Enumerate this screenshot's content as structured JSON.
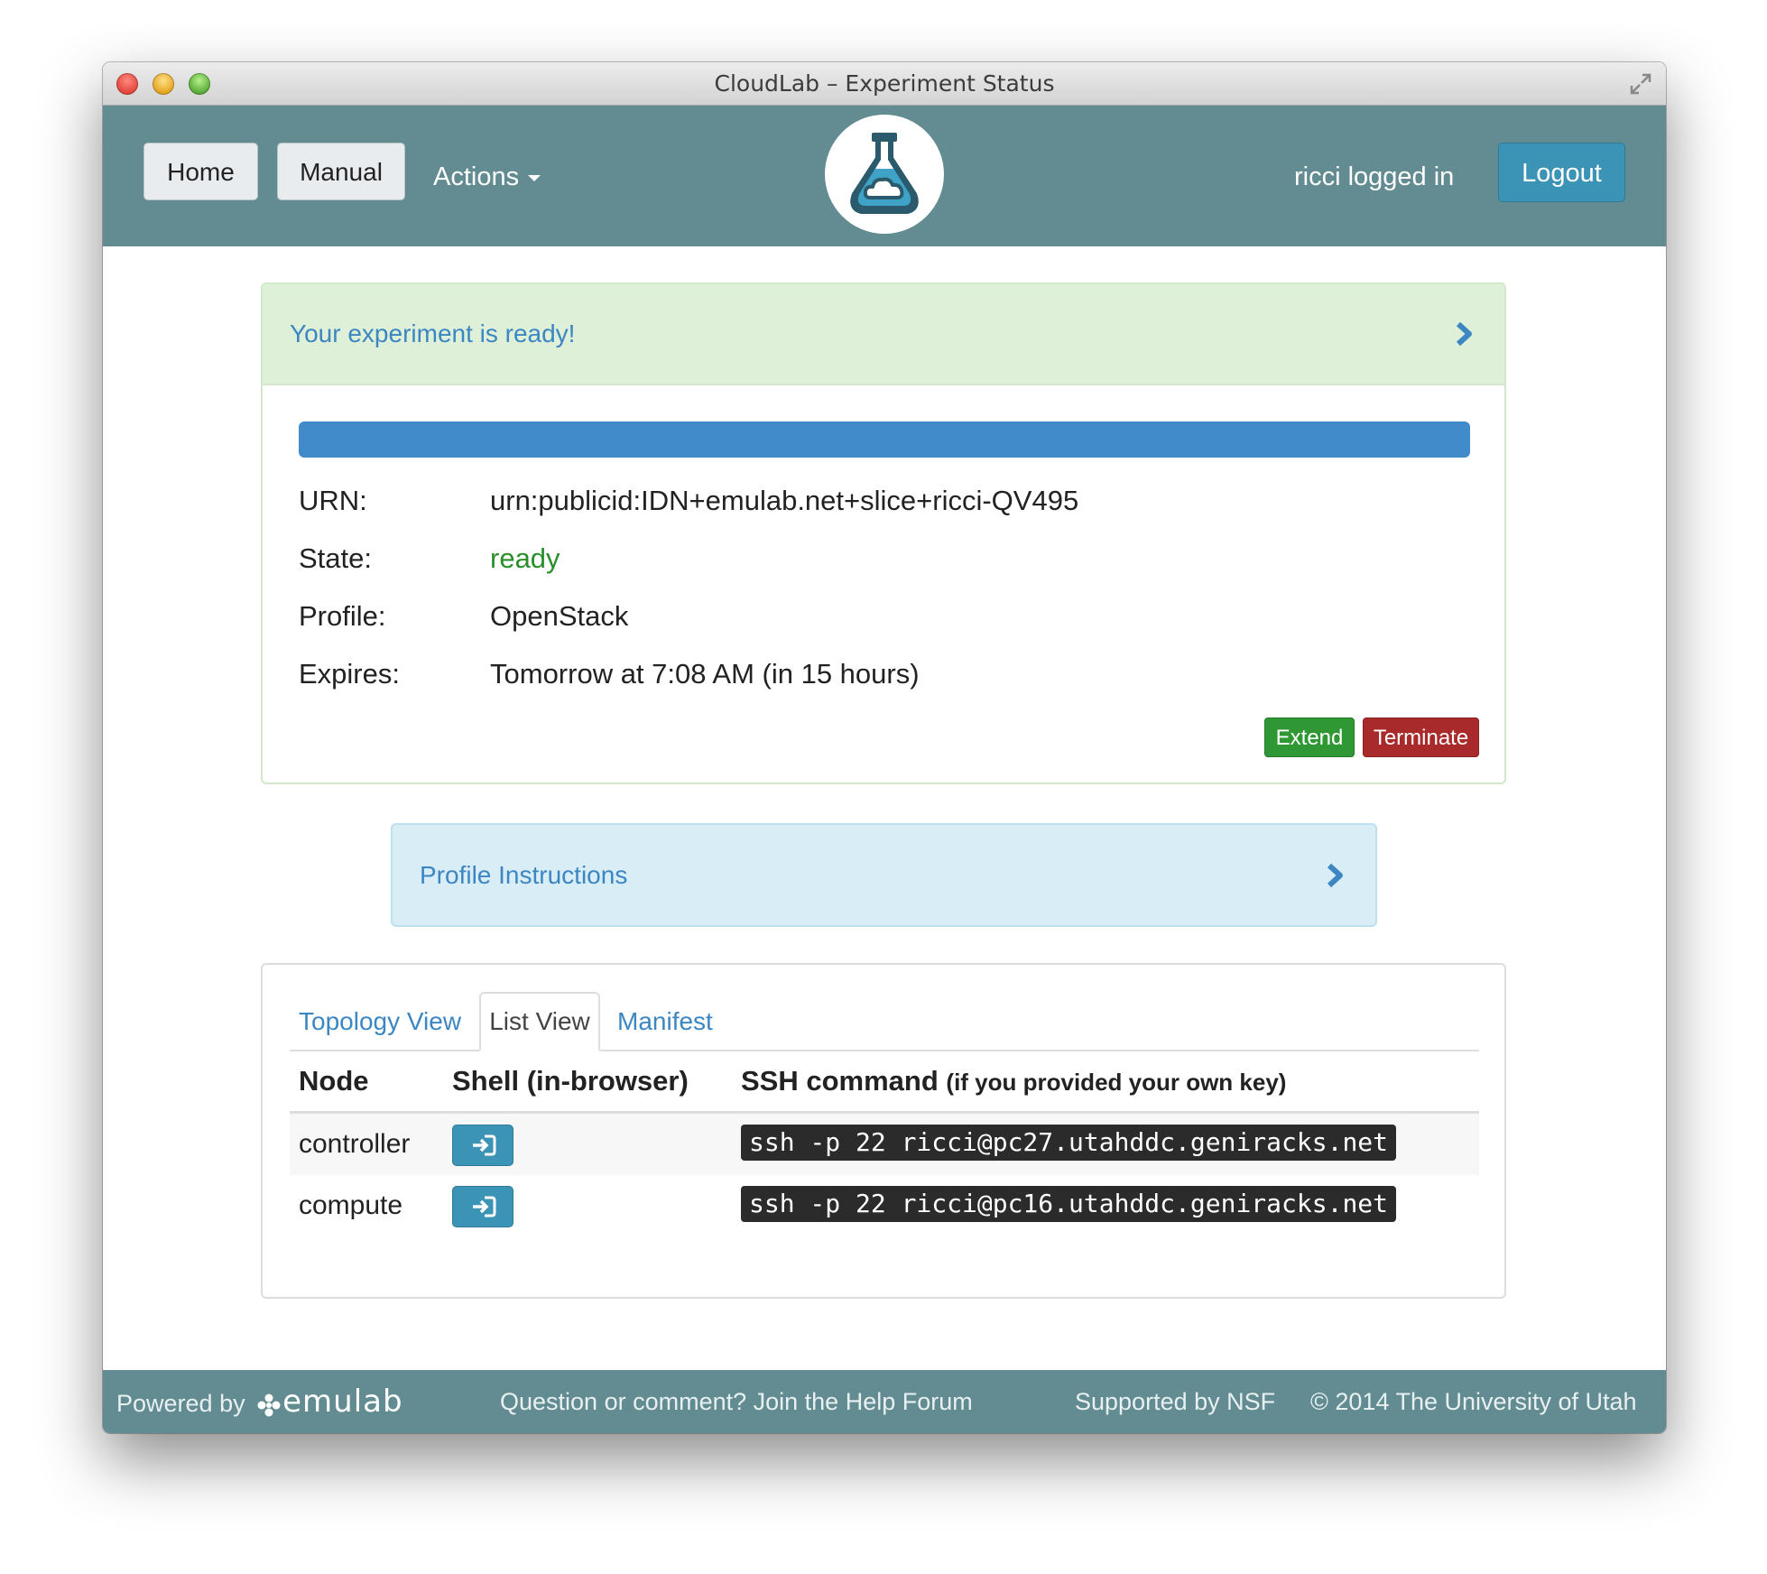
{
  "window": {
    "title": "CloudLab – Experiment Status"
  },
  "navbar": {
    "home_label": "Home",
    "manual_label": "Manual",
    "actions_label": "Actions",
    "user_status": "ricci logged in",
    "logout_label": "Logout"
  },
  "status": {
    "heading": "Your experiment is ready!",
    "progress_fraction": 1.0,
    "rows": [
      {
        "label": "URN:",
        "value": "urn:publicid:IDN+emulab.net+slice+ricci-QV495"
      },
      {
        "label": "State:",
        "value": "ready"
      },
      {
        "label": "Profile:",
        "value": "OpenStack"
      },
      {
        "label": "Expires:",
        "value": "Tomorrow at 7:08 AM (in 15 hours)"
      }
    ],
    "extend_label": "Extend",
    "terminate_label": "Terminate"
  },
  "instructions": {
    "heading": "Profile Instructions"
  },
  "nodes": {
    "tabs": [
      "Topology View",
      "List View",
      "Manifest"
    ],
    "active_tab": "List View",
    "headers": {
      "node": "Node",
      "shell": "Shell (in-browser)",
      "ssh": "SSH command",
      "ssh_note": "(if you provided your own key)"
    },
    "rows": [
      {
        "node": "controller",
        "ssh": "ssh -p 22 ricci@pc27.utahddc.geniracks.net"
      },
      {
        "node": "compute",
        "ssh": "ssh -p 22 ricci@pc16.utahddc.geniracks.net"
      }
    ]
  },
  "footer": {
    "powered_by": "Powered by",
    "emulab": "emulab",
    "help": "Question or comment? Join the Help Forum",
    "nsf": "Supported by NSF",
    "copyright": "© 2014 The University of Utah"
  },
  "colors": {
    "navbar": "#628c91",
    "accent_blue": "#3b93b5",
    "link_blue": "#3c86c2",
    "success_bg": "#dff0d8",
    "info_bg": "#d9edf7",
    "extend_green": "#2f9734",
    "terminate_red": "#a82a2a",
    "state_ready_green": "#2a8f2a"
  },
  "icons": {
    "fullscreen": "fullscreen-icon",
    "logo": "flask-cloud-logo",
    "heading_chevron": "chevron-right-icon",
    "shell": "sign-in-icon"
  }
}
